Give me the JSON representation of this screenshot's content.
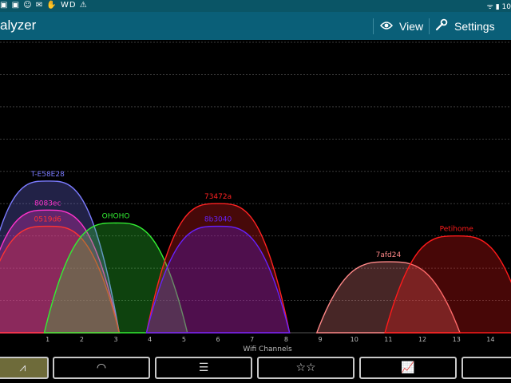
{
  "statusbar": {
    "left_icons": "▣ ▣ ☺ ✉ ✋ WD ⚠",
    "right_text": "ᯤ ▮ 10"
  },
  "actionbar": {
    "title": "alyzer",
    "view_label": "View",
    "settings_label": "Settings",
    "view_icon": "eye-icon",
    "settings_icon": "wrench-icon"
  },
  "chart_data": {
    "type": "area",
    "xlabel": "Wifi Channels",
    "x_ticks": [
      "1",
      "2",
      "3",
      "4",
      "5",
      "6",
      "7",
      "8",
      "9",
      "10",
      "11",
      "12",
      "13",
      "14"
    ],
    "xlim": [
      -0.4,
      14.6
    ],
    "ylim": [
      -100,
      -10
    ],
    "grid": true,
    "legend": "none",
    "series": [
      {
        "name": "T-E58E28",
        "channel": 1,
        "signal": -53,
        "color": "#7b7bff"
      },
      {
        "name": "8083ec",
        "channel": 1,
        "signal": -62,
        "color": "#ff33cc"
      },
      {
        "name": "0519d6",
        "channel": 1,
        "signal": -67,
        "color": "#ff3333"
      },
      {
        "name": "OHOHO",
        "channel": 3,
        "signal": -66,
        "color": "#33ee33"
      },
      {
        "name": "73472a",
        "channel": 6,
        "signal": -60,
        "color": "#ff2222"
      },
      {
        "name": "8b3040",
        "channel": 6,
        "signal": -67,
        "color": "#6622ff"
      },
      {
        "name": "7afd24",
        "channel": 11,
        "signal": -78,
        "color": "#ff8888"
      },
      {
        "name": "Petihome",
        "channel": 13,
        "signal": -70,
        "color": "#ff1a1a"
      }
    ]
  },
  "bottombar": {
    "tabs": [
      {
        "name": "tab-channel-graph",
        "icon": "channel-graph-icon",
        "glyph": "⩘",
        "active": true
      },
      {
        "name": "tab-signal-meter",
        "icon": "signal-meter-icon",
        "glyph": "◠",
        "active": false
      },
      {
        "name": "tab-ap-list",
        "icon": "list-icon",
        "glyph": "☰",
        "active": false
      },
      {
        "name": "tab-channel-rating",
        "icon": "stars-icon",
        "glyph": "☆☆",
        "active": false
      },
      {
        "name": "tab-time-graph",
        "icon": "time-graph-icon",
        "glyph": "📈",
        "active": false
      },
      {
        "name": "tab-more",
        "icon": "more-icon",
        "glyph": "",
        "active": false
      }
    ]
  }
}
